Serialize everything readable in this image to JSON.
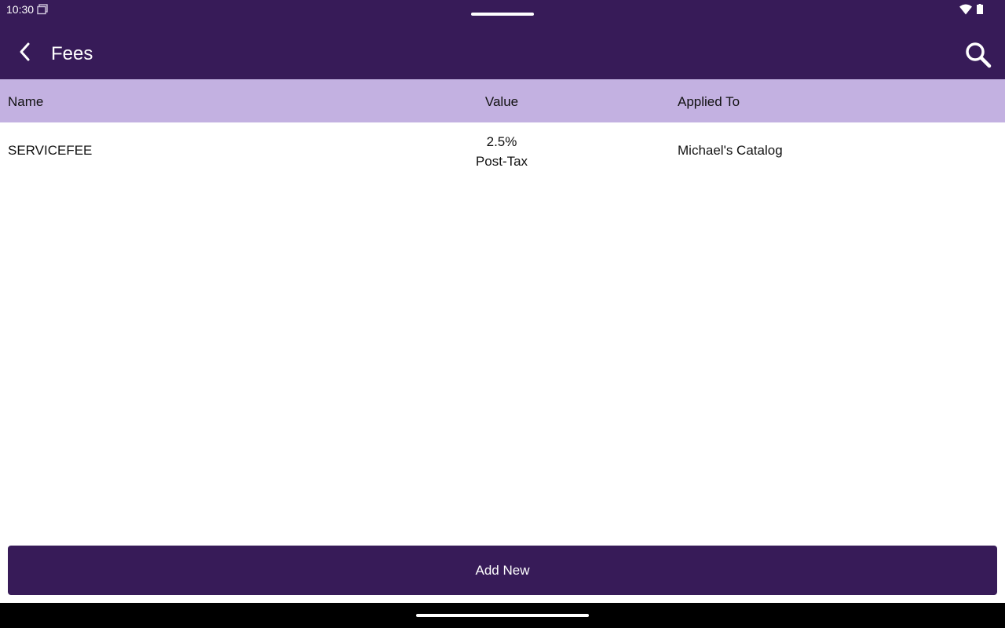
{
  "status_bar": {
    "time": "10:30",
    "icons": [
      "screenshot-icon",
      "wifi-icon",
      "battery-icon"
    ]
  },
  "app_bar": {
    "title": "Fees",
    "back_icon": "chevron-left-icon",
    "search_icon": "search-icon"
  },
  "table": {
    "columns": [
      "Name",
      "Value",
      "Applied To"
    ],
    "rows": [
      {
        "name": "SERVICEFEE",
        "value": "2.5%",
        "value_detail": "Post-Tax",
        "applied_to": "Michael's Catalog"
      }
    ]
  },
  "actions": {
    "add_new_label": "Add New"
  },
  "colors": {
    "primary": "#371b58",
    "header_background": "#c3b1e1",
    "background": "#ffffff",
    "nav_bar": "#000000"
  }
}
